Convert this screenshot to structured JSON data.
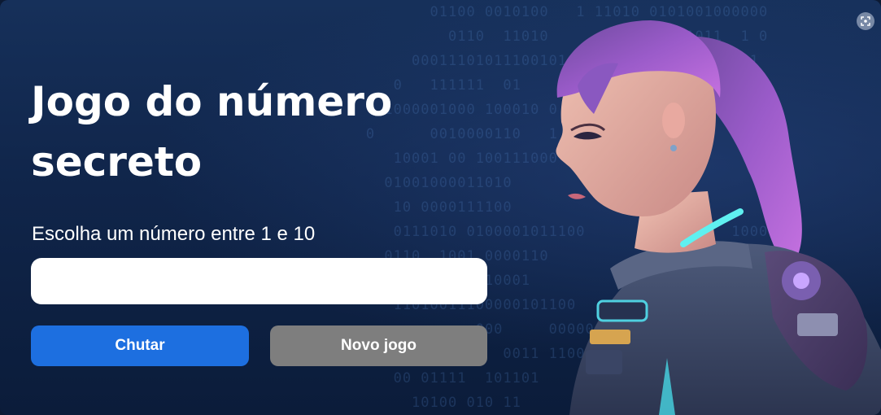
{
  "page": {
    "title": "Jogo do número secreto",
    "prompt_label": "Escolha um número entre 1 e 10",
    "input_value": "",
    "input_placeholder": ""
  },
  "buttons": {
    "guess_label": "Chutar",
    "new_game_label": "Novo jogo"
  },
  "background_binary": [
    "               01100 0010100   1 11010 0101001000000",
    "                 0110  11010      1   000011011  1 0",
    "             00011101011100101         110110000001",
    "           0   111111  01        0001   000001 0",
    "          1000001000 100010 0       0   0",
    "        0      0010000110   1",
    "           10001 00 100111000",
    "          01001000011010",
    "           10 0000111100",
    "           0111010 0100001011100      0         1000",
    "          0110  1001 0000110",
    "               01000110001",
    "           11010011100000101100",
    "                    000     00000",
    "                 1000  0011 11000",
    "           00 01111  101101",
    "             10100 010 11"
  ],
  "colors": {
    "primary_button": "#1d6fe0",
    "secondary_button": "#7e7e7e",
    "background_top": "#16305a",
    "background_bottom": "#0b1c3a",
    "text": "#ffffff"
  },
  "icons": {
    "corner": "fullscreen-icon",
    "illustration": "robot-woman-illustration"
  }
}
